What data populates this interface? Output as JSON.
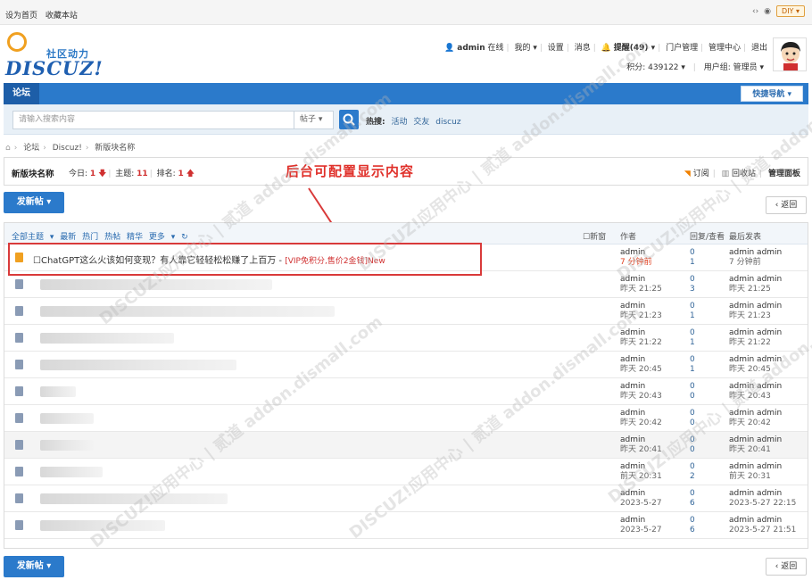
{
  "topbar": {
    "set_home": "设为首页",
    "bookmark": "收藏本站",
    "diy": "DIY"
  },
  "logo": {
    "cn": "社区动力",
    "en": "DISCUZ!"
  },
  "user": {
    "name": "admin",
    "online": "在线",
    "mine": "我的",
    "settings": "设置",
    "messages": "消息",
    "remind": "提醒(49)",
    "portal_manage": "门户管理",
    "admin_center": "管理中心",
    "logout": "退出",
    "credits": "积分: 439122",
    "usergroup": "用户组: 管理员"
  },
  "nav": {
    "forum": "论坛",
    "quick_nav": "快捷导航"
  },
  "search": {
    "placeholder": "请输入搜索内容",
    "scope": "帖子",
    "hot_label": "热搜:",
    "hot_terms": [
      "活动",
      "交友",
      "discuz"
    ]
  },
  "breadcrumb": [
    "论坛",
    "Discuz!",
    "新版块名称"
  ],
  "forum_info": {
    "name": "新版块名称",
    "today_label": "今日:",
    "today": "1",
    "topics_label": "主题:",
    "topics": "11",
    "rank_label": "排名:",
    "rank": "1",
    "subscribe": "订阅",
    "favorite": "回收站",
    "manage": "管理面板"
  },
  "annotation": "后台可配置显示内容",
  "buttons": {
    "new_post": "发新帖",
    "back": "返回"
  },
  "table_header": {
    "filters": [
      "全部主题",
      "最新",
      "热门",
      "热帖",
      "精华",
      "更多"
    ],
    "new_window": "新窗",
    "author": "作者",
    "reply_view": "回复/查看",
    "last_post": "最后发表"
  },
  "threads": [
    {
      "title": "ChatGPT这么火该如何变现？有人靠它轻轻松松赚了上百万 - ",
      "tag": "[VIP免积分,售价2金钱]New",
      "author": "admin",
      "time": "7 分钟前",
      "replies": "0",
      "views": "1",
      "last_user": "admin admin",
      "last_time": "7 分钟前"
    },
    {
      "title": "",
      "author": "admin",
      "time": "昨天 21:25",
      "replies": "0",
      "views": "3",
      "last_user": "admin admin",
      "last_time": "昨天 21:25"
    },
    {
      "title": "",
      "author": "admin",
      "time": "昨天 21:23",
      "replies": "0",
      "views": "1",
      "last_user": "admin admin",
      "last_time": "昨天 21:23"
    },
    {
      "title": "",
      "author": "admin",
      "time": "昨天 21:22",
      "replies": "0",
      "views": "1",
      "last_user": "admin admin",
      "last_time": "昨天 21:22"
    },
    {
      "title": "",
      "author": "admin",
      "time": "昨天 20:45",
      "replies": "0",
      "views": "1",
      "last_user": "admin admin",
      "last_time": "昨天 20:45"
    },
    {
      "title": "",
      "author": "admin",
      "time": "昨天 20:43",
      "replies": "0",
      "views": "0",
      "last_user": "admin admin",
      "last_time": "昨天 20:43"
    },
    {
      "title": "",
      "author": "admin",
      "time": "昨天 20:42",
      "replies": "0",
      "views": "0",
      "last_user": "admin admin",
      "last_time": "昨天 20:42"
    },
    {
      "title": "",
      "author": "admin",
      "time": "昨天 20:41",
      "replies": "0",
      "views": "0",
      "last_user": "admin admin",
      "last_time": "昨天 20:41"
    },
    {
      "title": "",
      "author": "admin",
      "time": "前天 20:31",
      "replies": "0",
      "views": "2",
      "last_user": "admin admin",
      "last_time": "前天 20:31"
    },
    {
      "title": "",
      "author": "admin",
      "time": "2023-5-27",
      "replies": "0",
      "views": "6",
      "last_user": "admin admin",
      "last_time": "2023-5-27 22:15"
    },
    {
      "title": "",
      "author": "admin",
      "time": "2023-5-27",
      "replies": "0",
      "views": "6",
      "last_user": "admin admin",
      "last_time": "2023-5-27 21:51"
    }
  ],
  "watermark": "DISCUZ!应用中心 | 贰道 addon.dismall.com"
}
